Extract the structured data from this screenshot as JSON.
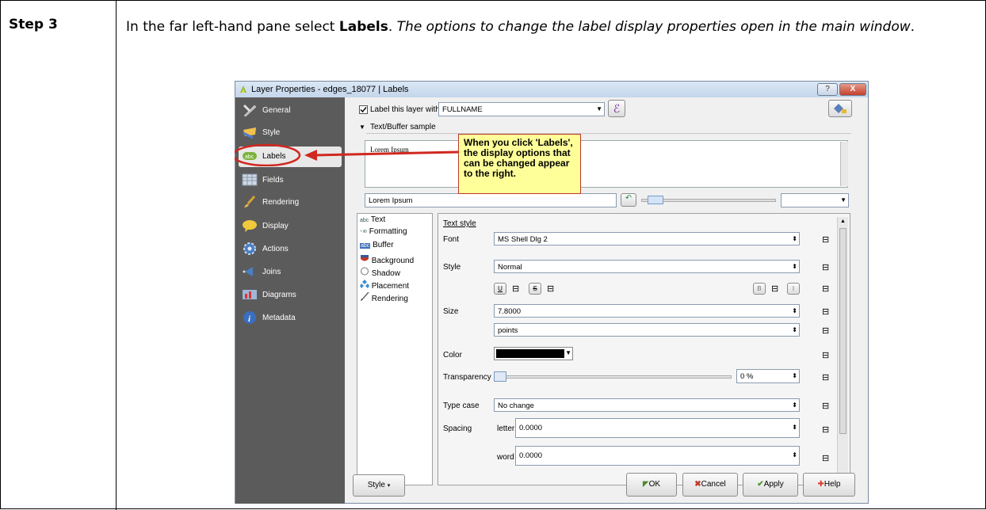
{
  "doc": {
    "step": "Step 3",
    "instr_part1": "In the far left-hand pane select ",
    "instr_bold": "Labels",
    "instr_part2": ". ",
    "instr_italic": "The options to change the label display properties open in the main window",
    "instr_end": "."
  },
  "dialog": {
    "title": "Layer Properties - edges_18077 | Labels",
    "help_btn": "?",
    "close_btn": "X"
  },
  "sidebar": {
    "items": [
      {
        "label": "General",
        "icon": "wrench-icon"
      },
      {
        "label": "Style",
        "icon": "paint-icon"
      },
      {
        "label": "Labels",
        "icon": "abc-label-icon"
      },
      {
        "label": "Fields",
        "icon": "table-icon"
      },
      {
        "label": "Rendering",
        "icon": "brush-icon"
      },
      {
        "label": "Display",
        "icon": "speech-bubble-icon"
      },
      {
        "label": "Actions",
        "icon": "gear-icon"
      },
      {
        "label": "Joins",
        "icon": "join-icon"
      },
      {
        "label": "Diagrams",
        "icon": "diagram-icon"
      },
      {
        "label": "Metadata",
        "icon": "info-icon"
      }
    ]
  },
  "labels": {
    "label_checkbox": "Label this layer with",
    "field_value": "FULLNAME",
    "sample_header": "Text/Buffer sample",
    "sample_text": "Lorem Ipsum",
    "sample_input": "Lorem Ipsum"
  },
  "callout": "When you click 'Labels', the display options that can be changed appear to the right.",
  "subnav": [
    "Text",
    "Formatting",
    "Buffer",
    "Background",
    "Shadow",
    "Placement",
    "Rendering"
  ],
  "subnav_prefix": {
    "text": "abc",
    "formatting": "+ab\n< c",
    "buffer": "abc"
  },
  "textstyle": {
    "heading": "Text style",
    "font_label": "Font",
    "font_value": "MS Shell Dlg 2",
    "style_label": "Style",
    "style_value": "Normal",
    "u": "U",
    "s": "S",
    "b": "B",
    "i": "I",
    "size_label": "Size",
    "size_value": "7.8000",
    "unit_value": "points",
    "color_label": "Color",
    "transparency_label": "Transparency",
    "transparency_value": "0 %",
    "typecase_label": "Type case",
    "typecase_value": "No change",
    "spacing_label": "Spacing",
    "letter_label": "letter",
    "letter_value": "0.0000",
    "word_label": "word",
    "word_value": "0.0000"
  },
  "footer": {
    "style": "Style",
    "ok": "OK",
    "cancel": "Cancel",
    "apply": "Apply",
    "help": "Help"
  },
  "colors": {
    "sidebar_bg": "#5b5b5b",
    "callout_bg": "#ffff99",
    "arrow": "#d0281f",
    "text_color_swatch": "#000000"
  }
}
